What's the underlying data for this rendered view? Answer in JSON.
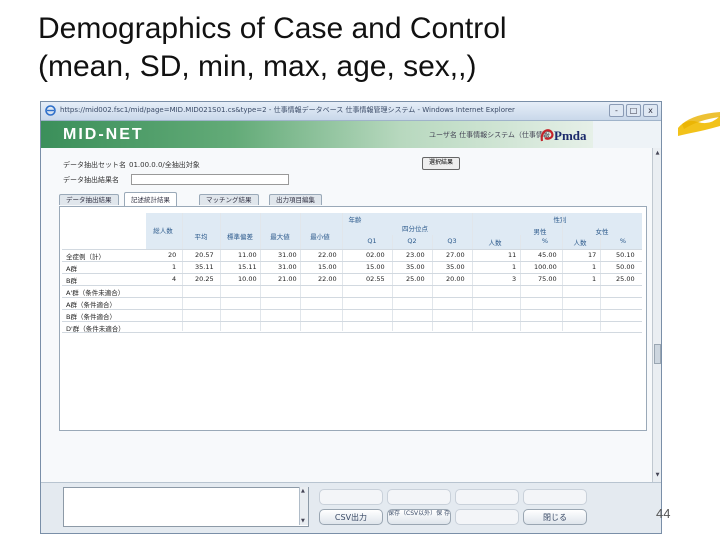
{
  "slide": {
    "title_line1": "Demographics of Case and Control",
    "title_line2": "(mean, SD, min, max, age, sex,,)",
    "page_number": "44"
  },
  "window": {
    "title": "https://mid002.fsc1/mid/page=MID.MID021S01.cs&type=2 - 仕事情報データベース 仕事情報管理システム - Windows Internet Explorer",
    "buttons": [
      "-",
      "□",
      "x"
    ]
  },
  "app": {
    "logo": "MID-NET",
    "user_info": "ユーザ名 仕事情報システム（仕事情報）",
    "brand": "Pmda"
  },
  "form": {
    "dataset_label": "データ抽出セット名",
    "dataset_value": "01.00.0.0/全抽出対象",
    "second_label": "データ抽出結果名",
    "select_button": "選択結果"
  },
  "tabs": [
    {
      "label": "データ抽出結果",
      "active": false
    },
    {
      "label": "記述統計結果",
      "active": true
    },
    {
      "label": "マッチング結果",
      "active": false
    },
    {
      "label": "出力項目編集",
      "active": false
    }
  ],
  "table": {
    "group_age": "年齢",
    "group_sex": "性別",
    "col_total": "総人数",
    "col_mean": "平均",
    "col_sd": "標準偏差",
    "col_max": "最大値",
    "col_min": "最小値",
    "col_quartile": "四分位点",
    "col_q1": "Q1",
    "col_q2": "Q2",
    "col_q3": "Q3",
    "col_male": "男性",
    "col_female": "女性",
    "col_male_n": "人数",
    "col_male_pct": "%",
    "col_female_n": "人数",
    "col_female_pct": "%",
    "rows": [
      {
        "label": "全症例（計）",
        "total": "20",
        "mean": "20.57",
        "sd": "11.00",
        "max": "31.00",
        "min": "22.00",
        "q1": "02.00",
        "q2": "23.00",
        "q3": "27.00",
        "male_n": "11",
        "male_pct": "45.00",
        "female_n": "17",
        "female_pct": "50.10"
      },
      {
        "label": "A群",
        "total": "1",
        "mean": "35.11",
        "sd": "15.11",
        "max": "31.00",
        "min": "15.00",
        "q1": "15.00",
        "q2": "35.00",
        "q3": "35.00",
        "male_n": "1",
        "male_pct": "100.00",
        "female_n": "1",
        "female_pct": "50.00"
      },
      {
        "label": "B群",
        "total": "4",
        "mean": "20.25",
        "sd": "10.00",
        "max": "21.00",
        "min": "22.00",
        "q1": "02.55",
        "q2": "25.00",
        "q3": "20.00",
        "male_n": "3",
        "male_pct": "75.00",
        "female_n": "1",
        "female_pct": "25.00"
      },
      {
        "label": "A'群（条件未適合）"
      },
      {
        "label": "A群（条件適合）"
      },
      {
        "label": "B群（条件適合）"
      },
      {
        "label": "D'群（条件未適合）"
      }
    ]
  },
  "footer": {
    "csv_button": "CSV出力",
    "save_button": "保存（CSV以外）保 存",
    "close_button": "閉じる"
  },
  "colors": {
    "banner_start": "#3b8f5a",
    "header_text": "#2c5a8c",
    "highlight": "#f2c21a"
  }
}
